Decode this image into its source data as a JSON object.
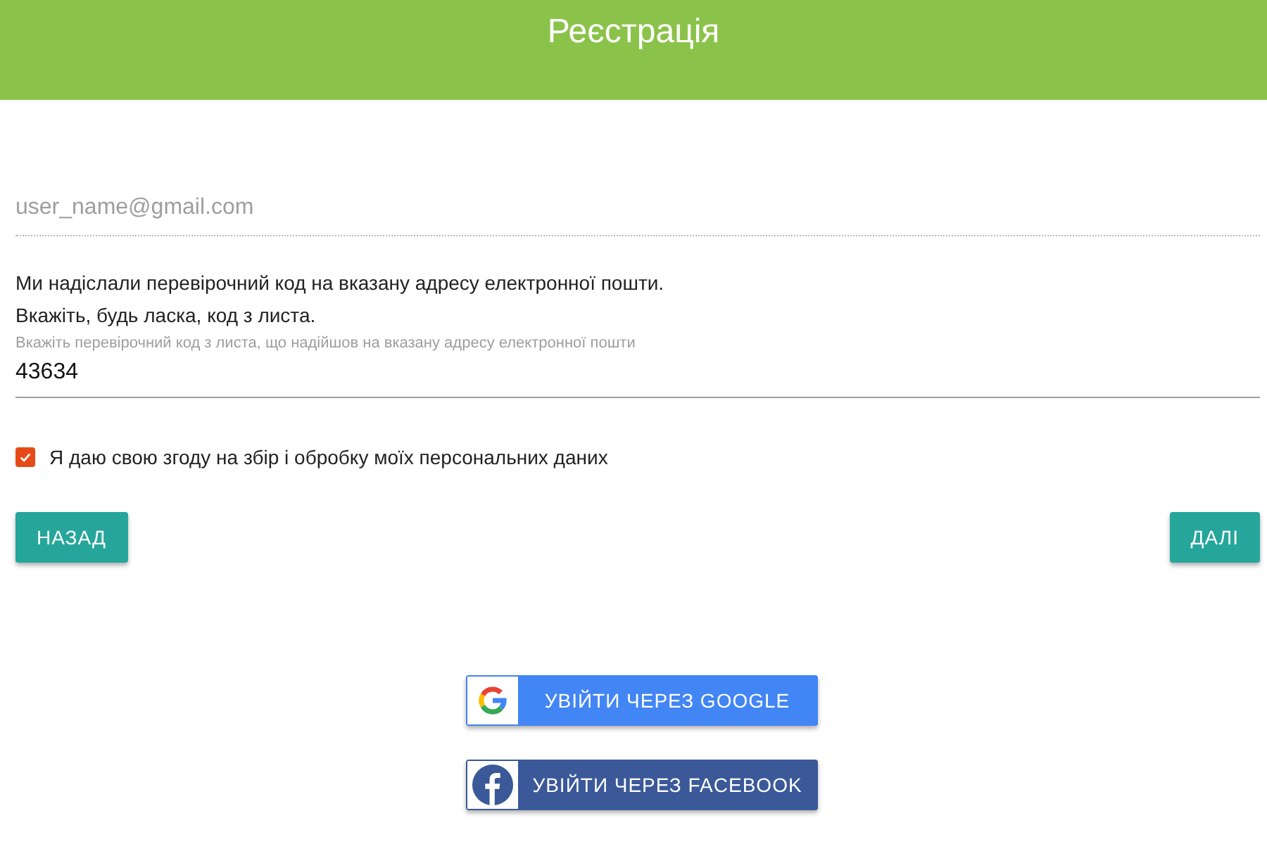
{
  "header": {
    "title": "Реєстрація"
  },
  "email_field": {
    "placeholder": "user_name@gmail.com"
  },
  "message": [
    "Ми надіслали перевірочний код на вказану адресу електронної пошти.",
    "Вкажіть, будь ласка, код з листа."
  ],
  "code_field": {
    "label": "Вкажіть перевірочний код з листа, що надійшов на вказану адресу електронної пошти",
    "value": "43634"
  },
  "consent": {
    "label": "Я даю свою згоду на збір і обробку моїх персональних даних",
    "checked": true
  },
  "buttons": {
    "back": "НАЗАД",
    "next": "ДАЛІ"
  },
  "social_buttons": [
    {
      "kind": "google",
      "label": "УВІЙТИ ЧЕРЕЗ GOOGLE"
    },
    {
      "kind": "facebook",
      "label": "УВІЙТИ ЧЕРЕЗ FACEBOOK"
    }
  ]
}
